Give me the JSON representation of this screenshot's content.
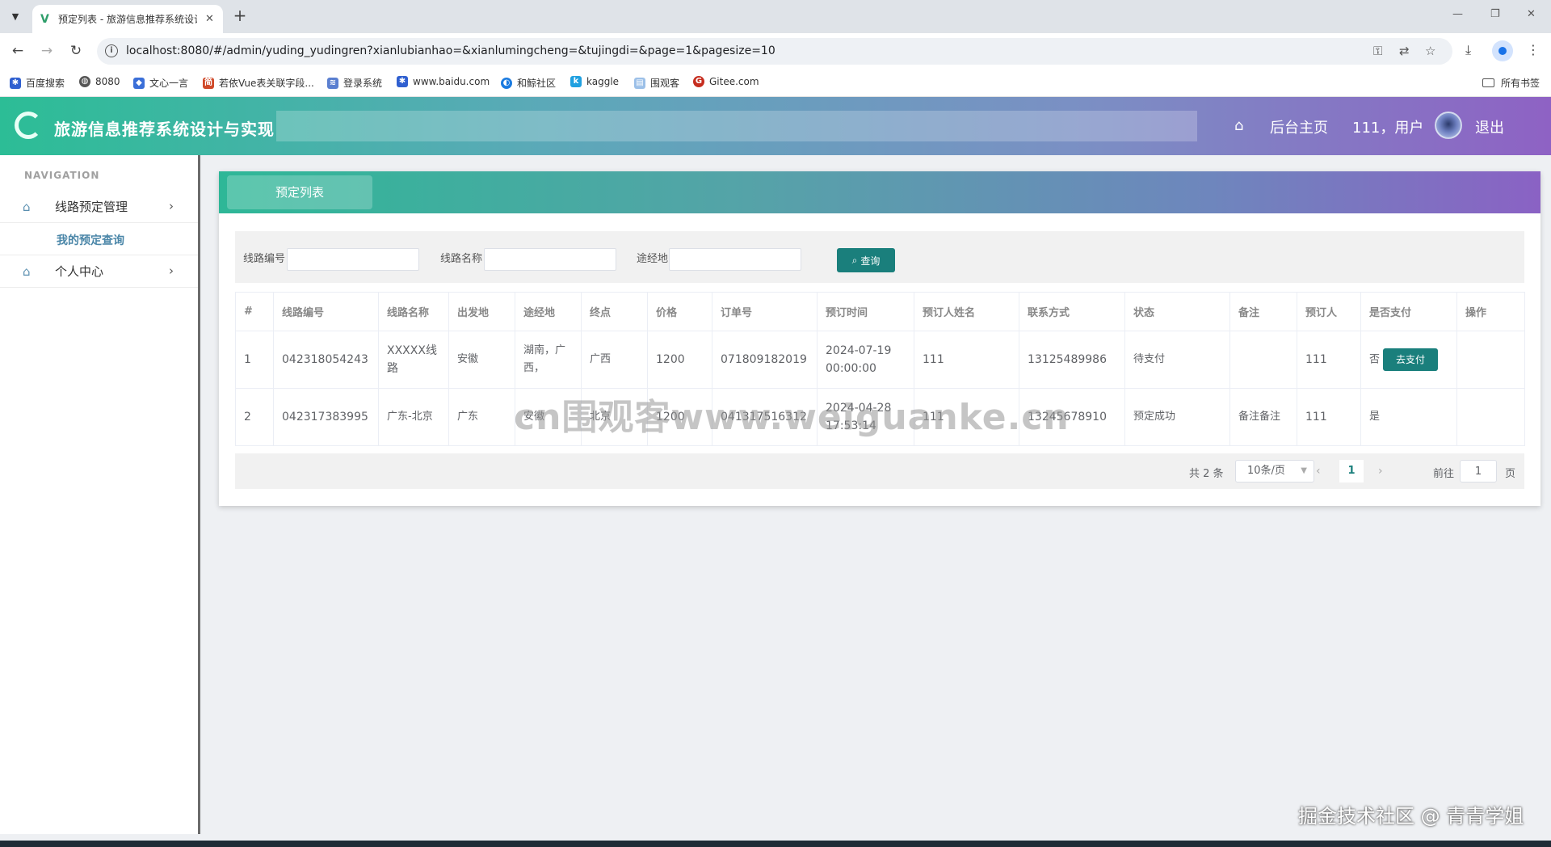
{
  "browser": {
    "tab_title": "预定列表 - 旅游信息推荐系统设计",
    "url": "localhost:8080/#/admin/yuding_yudingren?xianlubianhao=&xianlumingcheng=&tujingdi=&page=1&pagesize=10",
    "bookmarks": [
      "百度搜索",
      "8080",
      "文心一言",
      "若依Vue表关联字段...",
      "登录系统",
      "www.baidu.com",
      "和鲸社区",
      "kaggle",
      "围观客",
      "Gitee.com"
    ],
    "all_bookmarks": "所有书签"
  },
  "header": {
    "app_title": "旅游信息推荐系统设计与实现",
    "home_link": "后台主页",
    "user_text": "111，用户",
    "logout": "退出",
    "accent_start": "#2cbd96",
    "accent_end": "#8e62c4"
  },
  "sidebar": {
    "caption": "NAVIGATION",
    "items": [
      {
        "label": "线路预定管理",
        "icon": "home-icon"
      },
      {
        "label": "个人中心",
        "icon": "home-icon"
      }
    ],
    "sub_item": "我的预定查询"
  },
  "main": {
    "tab_label": "预定列表",
    "search": {
      "route_no_label": "线路编号",
      "route_name_label": "线路名称",
      "via_label": "途经地",
      "button": "查询"
    },
    "table": {
      "columns": [
        "#",
        "线路编号",
        "线路名称",
        "出发地",
        "途经地",
        "终点",
        "价格",
        "订单号",
        "预订时间",
        "预订人姓名",
        "联系方式",
        "状态",
        "备注",
        "预订人",
        "是否支付",
        "操作"
      ],
      "rows": [
        {
          "idx": "1",
          "route_no": "042318054243",
          "route_name": "XXXXX线路",
          "origin": "安徽",
          "via": "湖南，广西，",
          "destination": "广西",
          "price": "1200",
          "order_no": "071809182019",
          "time": "2024-07-19 00:00:00",
          "name": "111",
          "phone": "13125489986",
          "status": "待支付",
          "remark": "",
          "booker": "111",
          "paid": "否",
          "action": "去支付"
        },
        {
          "idx": "2",
          "route_no": "042317383995",
          "route_name": "广东-北京",
          "origin": "广东",
          "via": "安徽",
          "destination": "北京",
          "price": "1200",
          "order_no": "041317516312",
          "time": "2024-04-28 17:53:14",
          "name": "111",
          "phone": "13245678910",
          "status": "预定成功",
          "remark": "备注备注",
          "booker": "111",
          "paid": "是",
          "action": ""
        }
      ]
    },
    "pagination": {
      "total": "共 2 条",
      "page_size": "10条/页",
      "current": "1",
      "goto_label": "前往",
      "goto_value": "1",
      "page_suffix": "页"
    }
  },
  "overlay": {
    "watermark": "cn围观客www.weiguanke.cn",
    "credit": "掘金技术社区 @ 青青学姐"
  }
}
